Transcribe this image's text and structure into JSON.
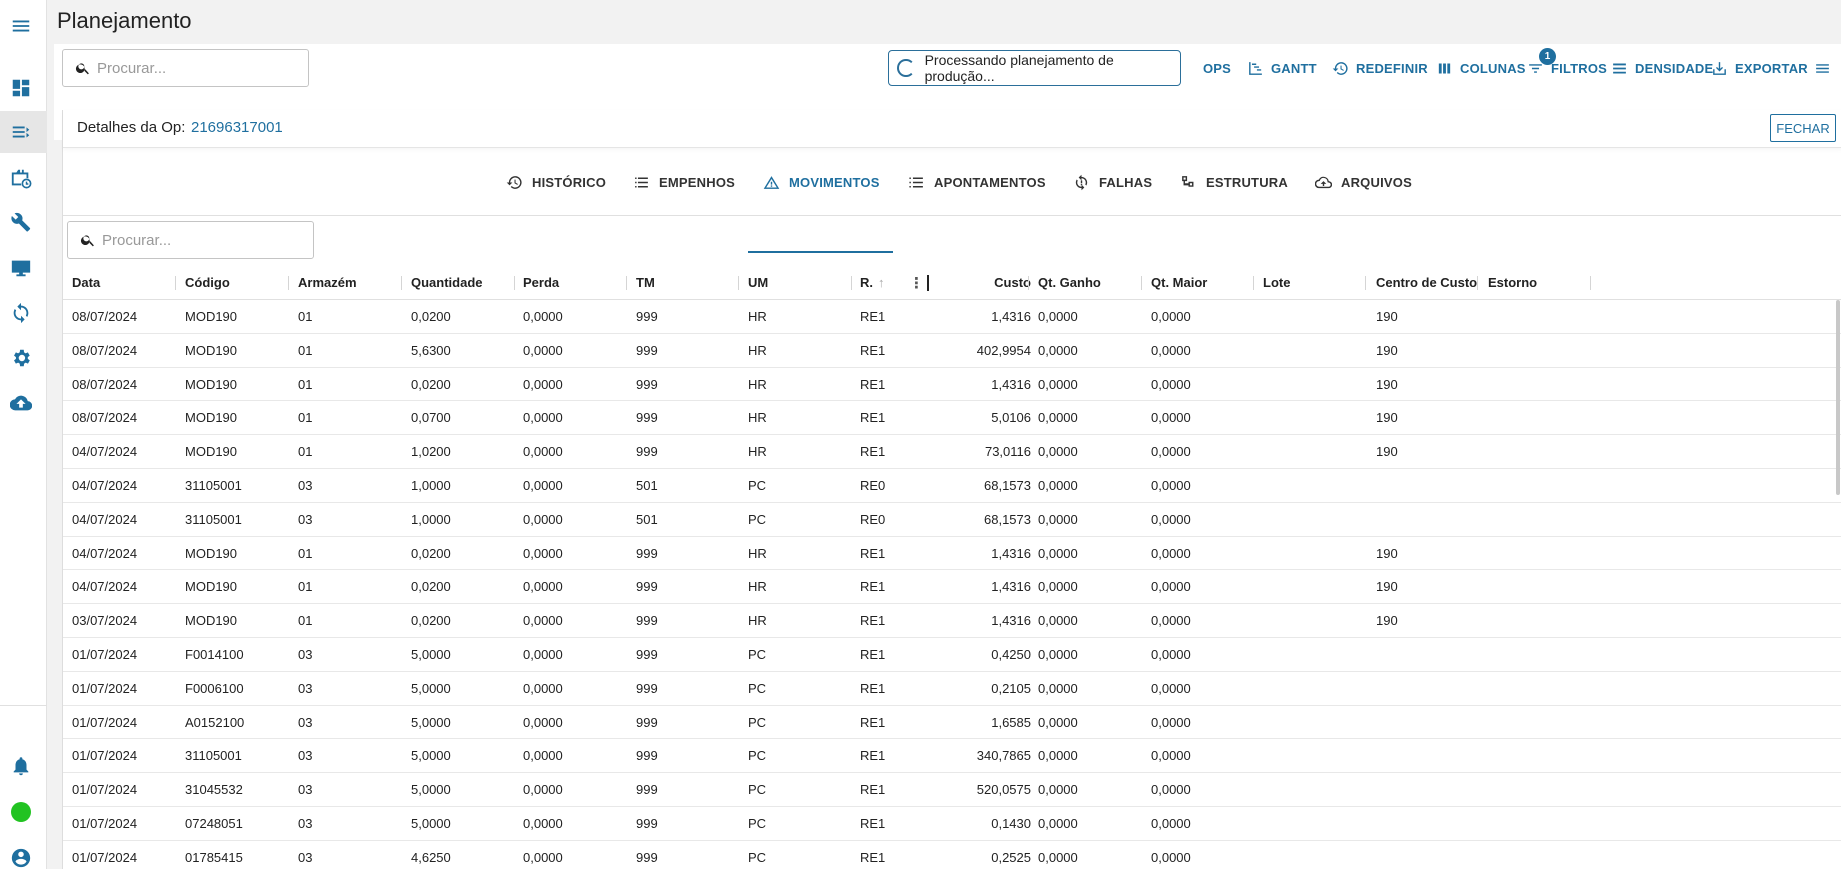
{
  "page": {
    "title": "Planejamento"
  },
  "sidebar": {
    "items": [
      {
        "icon": "menu-icon"
      },
      {
        "icon": "dashboard-icon"
      },
      {
        "icon": "list-icon"
      },
      {
        "icon": "briefcase-clock-icon"
      },
      {
        "icon": "tools-icon"
      },
      {
        "icon": "monitor-icon"
      },
      {
        "icon": "sync-icon"
      },
      {
        "icon": "gear-icon"
      },
      {
        "icon": "cloud-upload-icon"
      },
      {
        "icon": "bell-icon"
      },
      {
        "icon": "status-dot-icon"
      },
      {
        "icon": "account-icon"
      }
    ],
    "status_color": "#22c322"
  },
  "toolbar": {
    "search_placeholder": "Procurar...",
    "processing_text": "Processando planejamento de produção...",
    "ops": "OPS",
    "gantt": "GANTT",
    "reset": "REDEFINIR",
    "columns": "COLUNAS",
    "filters": "FILTROS",
    "filters_badge": "1",
    "density": "DENSIDADE",
    "export": "EXPORTAR"
  },
  "details": {
    "label": "Detalhes da Op:",
    "op_number": "21696317001",
    "close": "FECHAR",
    "tabs": [
      "HISTÓRICO",
      "EMPENHOS",
      "MOVIMENTOS",
      "APONTAMENTOS",
      "FALHAS",
      "ESTRUTURA",
      "ARQUIVOS"
    ],
    "active_tab": "MOVIMENTOS",
    "search_placeholder": "Procurar..."
  },
  "table": {
    "columns": [
      "Data",
      "Código",
      "Armazém",
      "Quantidade",
      "Perda",
      "TM",
      "UM",
      "R.",
      "Custo",
      "Qt. Ganho",
      "Qt. Maior",
      "Lote",
      "Centro de Custo",
      "Estorno"
    ],
    "rows": [
      [
        "08/07/2024",
        "MOD190",
        "01",
        "0,0200",
        "0,0000",
        "999",
        "HR",
        "RE1",
        "1,4316",
        "0,0000",
        "0,0000",
        "",
        "190",
        ""
      ],
      [
        "08/07/2024",
        "MOD190",
        "01",
        "5,6300",
        "0,0000",
        "999",
        "HR",
        "RE1",
        "402,9954",
        "0,0000",
        "0,0000",
        "",
        "190",
        ""
      ],
      [
        "08/07/2024",
        "MOD190",
        "01",
        "0,0200",
        "0,0000",
        "999",
        "HR",
        "RE1",
        "1,4316",
        "0,0000",
        "0,0000",
        "",
        "190",
        ""
      ],
      [
        "08/07/2024",
        "MOD190",
        "01",
        "0,0700",
        "0,0000",
        "999",
        "HR",
        "RE1",
        "5,0106",
        "0,0000",
        "0,0000",
        "",
        "190",
        ""
      ],
      [
        "04/07/2024",
        "MOD190",
        "01",
        "1,0200",
        "0,0000",
        "999",
        "HR",
        "RE1",
        "73,0116",
        "0,0000",
        "0,0000",
        "",
        "190",
        ""
      ],
      [
        "04/07/2024",
        "31105001",
        "03",
        "1,0000",
        "0,0000",
        "501",
        "PC",
        "RE0",
        "68,1573",
        "0,0000",
        "0,0000",
        "",
        "",
        ""
      ],
      [
        "04/07/2024",
        "31105001",
        "03",
        "1,0000",
        "0,0000",
        "501",
        "PC",
        "RE0",
        "68,1573",
        "0,0000",
        "0,0000",
        "",
        "",
        ""
      ],
      [
        "04/07/2024",
        "MOD190",
        "01",
        "0,0200",
        "0,0000",
        "999",
        "HR",
        "RE1",
        "1,4316",
        "0,0000",
        "0,0000",
        "",
        "190",
        ""
      ],
      [
        "04/07/2024",
        "MOD190",
        "01",
        "0,0200",
        "0,0000",
        "999",
        "HR",
        "RE1",
        "1,4316",
        "0,0000",
        "0,0000",
        "",
        "190",
        ""
      ],
      [
        "03/07/2024",
        "MOD190",
        "01",
        "0,0200",
        "0,0000",
        "999",
        "HR",
        "RE1",
        "1,4316",
        "0,0000",
        "0,0000",
        "",
        "190",
        ""
      ],
      [
        "01/07/2024",
        "F0014100",
        "03",
        "5,0000",
        "0,0000",
        "999",
        "PC",
        "RE1",
        "0,4250",
        "0,0000",
        "0,0000",
        "",
        "",
        ""
      ],
      [
        "01/07/2024",
        "F0006100",
        "03",
        "5,0000",
        "0,0000",
        "999",
        "PC",
        "RE1",
        "0,2105",
        "0,0000",
        "0,0000",
        "",
        "",
        ""
      ],
      [
        "01/07/2024",
        "A0152100",
        "03",
        "5,0000",
        "0,0000",
        "999",
        "PC",
        "RE1",
        "1,6585",
        "0,0000",
        "0,0000",
        "",
        "",
        ""
      ],
      [
        "01/07/2024",
        "31105001",
        "03",
        "5,0000",
        "0,0000",
        "999",
        "PC",
        "RE1",
        "340,7865",
        "0,0000",
        "0,0000",
        "",
        "",
        ""
      ],
      [
        "01/07/2024",
        "31045532",
        "03",
        "5,0000",
        "0,0000",
        "999",
        "PC",
        "RE1",
        "520,0575",
        "0,0000",
        "0,0000",
        "",
        "",
        ""
      ],
      [
        "01/07/2024",
        "07248051",
        "03",
        "5,0000",
        "0,0000",
        "999",
        "PC",
        "RE1",
        "0,1430",
        "0,0000",
        "0,0000",
        "",
        "",
        ""
      ],
      [
        "01/07/2024",
        "01785415",
        "03",
        "4,6250",
        "0,0000",
        "999",
        "PC",
        "RE1",
        "0,2525",
        "0,0000",
        "0,0000",
        "",
        "",
        ""
      ]
    ]
  },
  "colors": {
    "accent": "#1f6f9f",
    "status_ok": "#22c322"
  }
}
